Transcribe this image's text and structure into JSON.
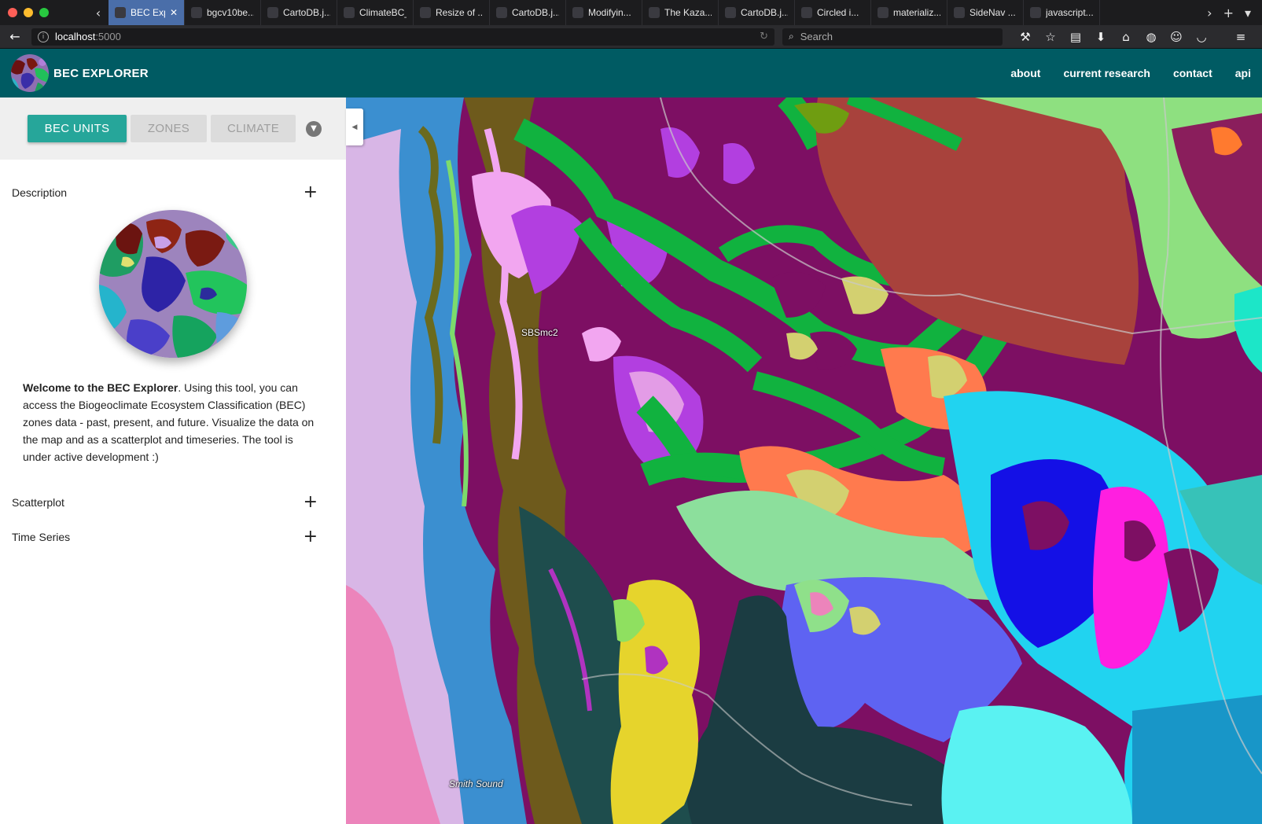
{
  "browser": {
    "tabs": [
      {
        "label": "BEC Explo...",
        "active": true,
        "close": "✕"
      },
      {
        "label": "bgcv10be...",
        "active": false
      },
      {
        "label": "CartoDB.j...",
        "active": false
      },
      {
        "label": "ClimateBC_H...",
        "active": false
      },
      {
        "label": "Resize of ...",
        "active": false
      },
      {
        "label": "CartoDB.j...",
        "active": false
      },
      {
        "label": "Modifyin...",
        "active": false
      },
      {
        "label": "The Kaza...",
        "active": false
      },
      {
        "label": "CartoDB.j...",
        "active": false
      },
      {
        "label": "Circled i...",
        "active": false
      },
      {
        "label": "materializ...",
        "active": false
      },
      {
        "label": "SideNav ...",
        "active": false
      },
      {
        "label": "javascript...",
        "active": false
      }
    ],
    "url_host": "localhost",
    "url_port": ":5000",
    "search_placeholder": "Search"
  },
  "header": {
    "title": "BEC EXPLORER",
    "nav": [
      "about",
      "current research",
      "contact",
      "api"
    ]
  },
  "sidebar": {
    "buttons": {
      "bec_units": "BEC UNITS",
      "zones": "ZONES",
      "climate": "CLIMATE"
    },
    "sections": {
      "description": "Description",
      "scatterplot": "Scatterplot",
      "time_series": "Time Series"
    },
    "welcome_bold": "Welcome to the BEC Explorer",
    "welcome_text": ". Using this tool, you can access the Biogeoclimate Ecosystem Classification (BEC) zones data - past, present, and future. Visualize the data on the map and as a scatterplot and timeseries. The tool is under active development :)"
  },
  "map": {
    "unit_label": "SBSmc2",
    "place_label": "Smith Sound"
  },
  "colors": {
    "accent": "#26a69a",
    "header": "#005b63",
    "active_tab": "#4a6ea9"
  }
}
